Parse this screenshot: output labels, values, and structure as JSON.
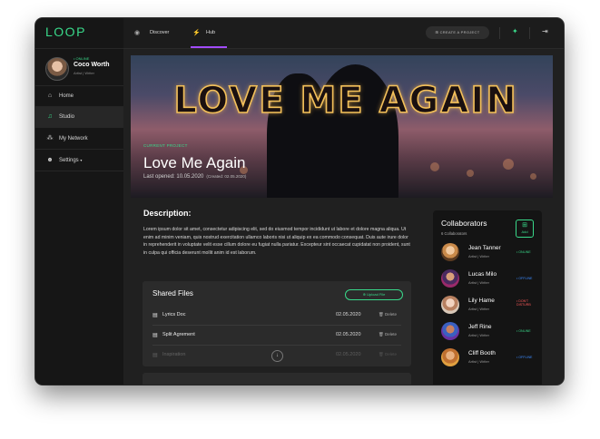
{
  "app": {
    "logo": "LOOP"
  },
  "colors": {
    "accent": "#39d98a",
    "active_tab": "#a24cff",
    "offline": "#3d8bff",
    "busy": "#ff5a5a"
  },
  "profile": {
    "status": "• ONLINE",
    "name": "Coco Worth",
    "role": "Artist | Writer"
  },
  "sidebar": {
    "items": [
      {
        "label": "Home",
        "icon": "home-icon"
      },
      {
        "label": "Studio",
        "icon": "music-note-icon"
      },
      {
        "label": "My Network",
        "icon": "network-icon"
      },
      {
        "label": "Settings",
        "icon": "users-icon"
      }
    ]
  },
  "topbar": {
    "tabs": [
      {
        "label": "Discover",
        "icon": "eye-icon"
      },
      {
        "label": "Hub",
        "icon": "hub-icon"
      }
    ],
    "create_label": "CREATE A PROJECT"
  },
  "project": {
    "banner_text": "LOVE ME AGAIN",
    "label": "CURRENT PROJECT",
    "name": "Love Me Again",
    "last_opened": "Last opened: 10.05.2020",
    "created": "(Created: 02.05.2020)"
  },
  "description": {
    "title": "Description:",
    "text": "Lorem ipsum dolor sit amet, consectetur adipiscing elit, sed do eiusmod tempor incididunt ut labore et dolore magna aliqua. Ut enim ad minim veniam, quis nostrud exercitation ullamco laboris nisi ut aliquip ex ea commodo consequat. Duis aute irure dolor in reprehenderit in voluptate velit esse cillum dolore eu fugiat nulla pariatur. Excepteur sint occaecat cupidatat non proident, sunt in culpa qui officia deserunt mollit anim id est laborum."
  },
  "files": {
    "title": "Shared Files",
    "upload_label": "Upload File",
    "delete_label": "Delete",
    "rows": [
      {
        "name": "Lyrics Doc",
        "date": "02.05.2020"
      },
      {
        "name": "Split Agrement",
        "date": "02.05.2020"
      },
      {
        "name": "Inspiration",
        "date": "02.05.2020"
      }
    ]
  },
  "collaborators": {
    "title": "Collaborators",
    "count": "6 Collaborators",
    "add_label": "Add",
    "people": [
      {
        "name": "Jean Tanner",
        "role": "Artist | Writer",
        "status": "• ONLINE",
        "status_color": "#39d98a"
      },
      {
        "name": "Lucas Milo",
        "role": "Artist | Writer",
        "status": "• OFFLINE",
        "status_color": "#3d8bff"
      },
      {
        "name": "Lily Hame",
        "role": "Artist | Writer",
        "status": "• DON'T DISTURB",
        "status_color": "#ff5a5a"
      },
      {
        "name": "Jeff Rine",
        "role": "Artist | Writer",
        "status": "• ONLINE",
        "status_color": "#39d98a"
      },
      {
        "name": "Cliff Booth",
        "role": "Artist | Writer",
        "status": "• OFFLINE",
        "status_color": "#3d8bff"
      }
    ]
  }
}
